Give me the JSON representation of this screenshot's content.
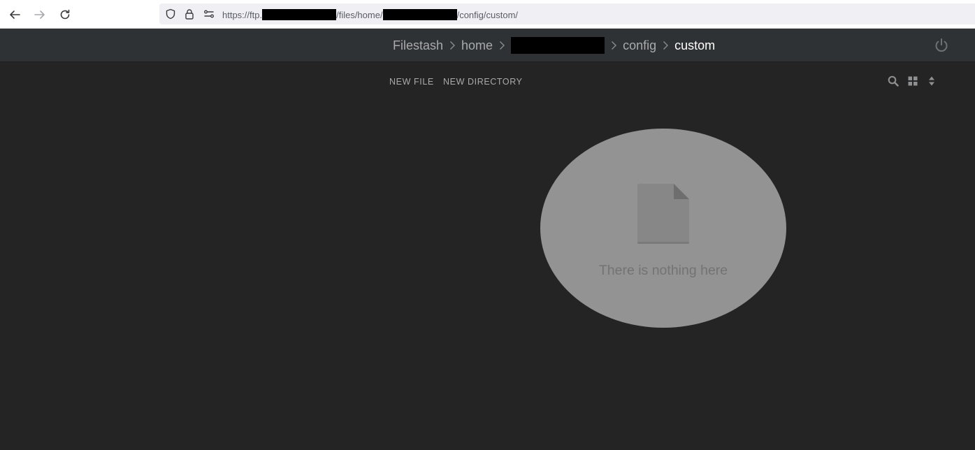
{
  "browser": {
    "url_prefix": "https://ftp.",
    "url_middle": "/files/home/",
    "url_suffix": "/config/custom/",
    "icons": [
      "back-arrow-icon",
      "forward-arrow-icon",
      "reload-icon",
      "shield-icon",
      "lock-icon",
      "permissions-icon"
    ]
  },
  "header": {
    "breadcrumb": {
      "root": "Filestash",
      "home": "home",
      "config": "config",
      "current": "custom"
    },
    "icons": [
      "chevron-right-icon",
      "power-icon"
    ]
  },
  "toolbar": {
    "new_file": "NEW FILE",
    "new_directory": "NEW DIRECTORY",
    "icons": [
      "search-icon",
      "grid-view-icon",
      "sort-icon"
    ]
  },
  "empty_state": {
    "message": "There is nothing here",
    "icon": "file-icon"
  },
  "colors": {
    "page_bg": "#242424",
    "header_bg": "#2f3235",
    "muted_text": "#a9aaab",
    "empty_bubble": "#939393"
  }
}
